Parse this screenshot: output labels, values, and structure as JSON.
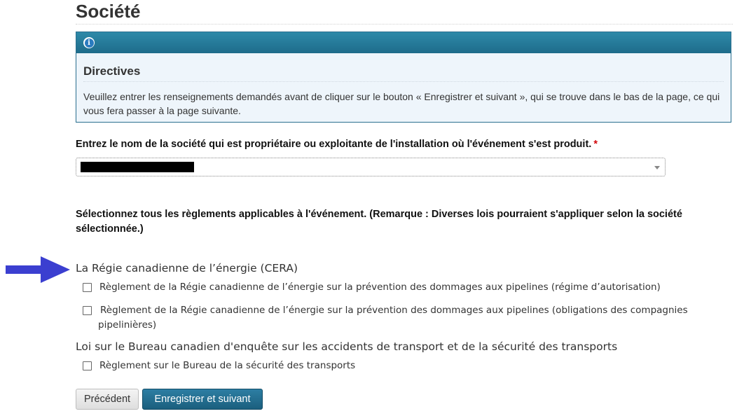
{
  "page": {
    "title": "Société"
  },
  "alert": {
    "icon": "info-icon",
    "heading": "Directives",
    "body": "Veuillez entrer les renseignements demandés avant de cliquer sur le bouton « Enregistrer et suivant », qui se trouve dans le bas de la page, ce qui vous fera passer à la page suivante."
  },
  "company_field": {
    "label": "Entrez le nom de la société qui est propriétaire ou exploitante de l'installation où l'événement s'est produit.",
    "required_marker": "*",
    "selected_value_redacted": true
  },
  "regulations": {
    "prompt": "Sélectionnez tous les règlements applicables à l'événement. (Remarque : Diverses lois pourraient s'appliquer selon la société sélectionnée.)",
    "groups": [
      {
        "title": "La Régie canadienne de l’énergie (CERA)",
        "items": [
          {
            "label": "Règlement de la Régie canadienne de l’énergie sur la prévention des dommages aux pipelines (régime d’autorisation)",
            "checked": false
          },
          {
            "label": "Règlement de la Régie canadienne de l’énergie sur la prévention des dommages aux pipelines (obligations des compagnies pipelinières)",
            "checked": false
          }
        ]
      },
      {
        "title": "Loi sur le Bureau canadien d'enquête sur les accidents de transport et de la sécurité des transports",
        "items": [
          {
            "label": "Règlement sur le Bureau de la sécurité des transports",
            "checked": false
          }
        ]
      }
    ]
  },
  "buttons": {
    "previous": "Précédent",
    "save_next": "Enregistrer et suivant"
  },
  "colors": {
    "alert_header": "#1e6c8b",
    "primary_button": "#1b5f7e",
    "required": "#d3080c",
    "annotation_arrow": "#3b3fd0"
  }
}
